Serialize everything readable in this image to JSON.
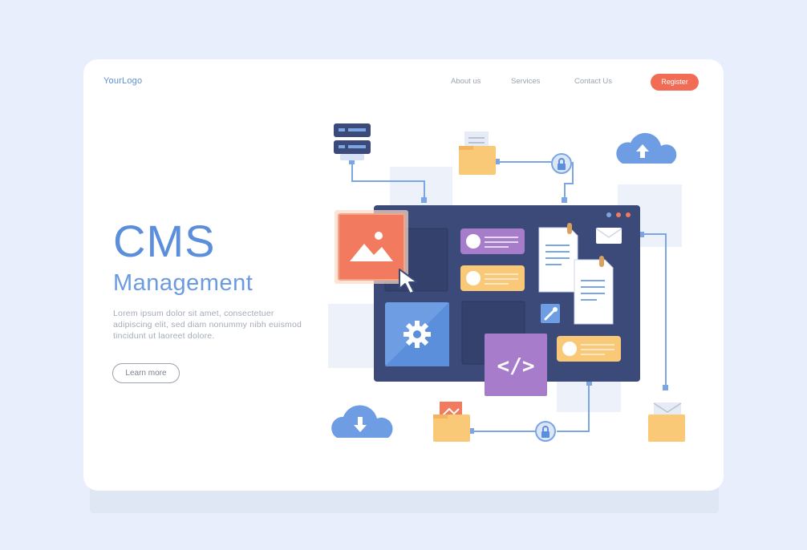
{
  "header": {
    "logo": "YourLogo",
    "nav": [
      {
        "label": "About us"
      },
      {
        "label": "Services"
      },
      {
        "label": "Contact Us"
      }
    ],
    "register_label": "Register"
  },
  "hero": {
    "title": "CMS",
    "subtitle": "Management",
    "description": "Lorem ipsum dolor sit amet, consectetuer adipiscing elit, sed diam nonummy nibh euismod tincidunt ut laoreet dolore.",
    "cta_label": "Learn more"
  },
  "illustration": {
    "code_symbol": "</>",
    "icons": [
      "server-icon",
      "folder-icon",
      "lock-icon",
      "cloud-upload-icon",
      "cloud-download-icon",
      "image-icon",
      "cursor-icon",
      "gear-icon",
      "wrench-icon",
      "document-icon",
      "envelope-icon",
      "code-icon"
    ]
  },
  "colors": {
    "background": "#e8eefb",
    "card": "#ffffff",
    "accent_blue": "#5b8edb",
    "register": "#f26b55",
    "dashboard": "#3c4a7a",
    "purple": "#a77ccb",
    "yellow": "#f9c978",
    "coral": "#f27a5e"
  }
}
